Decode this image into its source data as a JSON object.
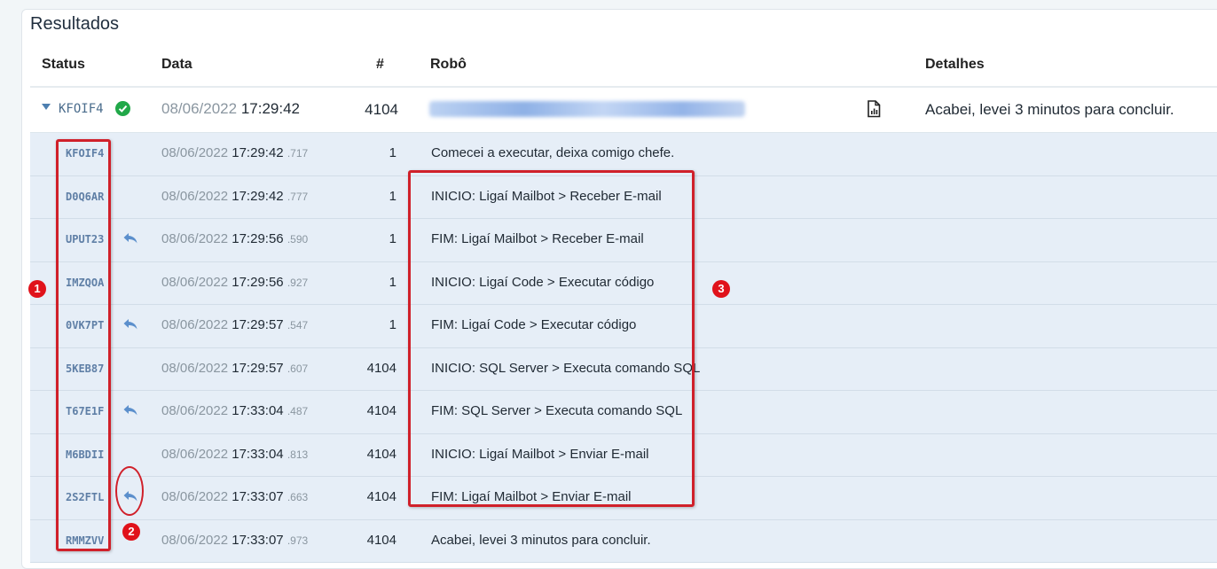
{
  "section_title": "Resultados",
  "columns": {
    "status": "Status",
    "data": "Data",
    "num": "#",
    "robo": "Robô",
    "detalhes": "Detalhes"
  },
  "main_row": {
    "code": "KFOIF4",
    "status_icon": "check-circle-icon",
    "date": "08/06/2022",
    "time": "17:29:42",
    "num": "4104",
    "robo": "(blurred)",
    "details_icon": "report-document-icon",
    "details": "Acabei, levei 3 minutos para concluir."
  },
  "log_rows": [
    {
      "code": "KFOIF4",
      "reply": false,
      "date": "08/06/2022",
      "time": "17:29:42",
      "ms": ".717",
      "num": "1",
      "msg": "Comecei a executar, deixa comigo chefe."
    },
    {
      "code": "D0Q6AR",
      "reply": false,
      "date": "08/06/2022",
      "time": "17:29:42",
      "ms": ".777",
      "num": "1",
      "msg": "INICIO: Ligaí Mailbot > Receber E-mail"
    },
    {
      "code": "UPUT23",
      "reply": true,
      "date": "08/06/2022",
      "time": "17:29:56",
      "ms": ".590",
      "num": "1",
      "msg": "FIM: Ligaí Mailbot > Receber E-mail"
    },
    {
      "code": "IMZQOA",
      "reply": false,
      "date": "08/06/2022",
      "time": "17:29:56",
      "ms": ".927",
      "num": "1",
      "msg": "INICIO: Ligaí Code > Executar código"
    },
    {
      "code": "0VK7PT",
      "reply": true,
      "date": "08/06/2022",
      "time": "17:29:57",
      "ms": ".547",
      "num": "1",
      "msg": "FIM: Ligaí Code > Executar código"
    },
    {
      "code": "5KEB87",
      "reply": false,
      "date": "08/06/2022",
      "time": "17:29:57",
      "ms": ".607",
      "num": "4104",
      "msg": "INICIO: SQL Server > Executa comando SQL"
    },
    {
      "code": "T67E1F",
      "reply": true,
      "date": "08/06/2022",
      "time": "17:33:04",
      "ms": ".487",
      "num": "4104",
      "msg": "FIM: SQL Server > Executa comando SQL"
    },
    {
      "code": "M6BDII",
      "reply": false,
      "date": "08/06/2022",
      "time": "17:33:04",
      "ms": ".813",
      "num": "4104",
      "msg": "INICIO: Ligaí Mailbot > Enviar E-mail"
    },
    {
      "code": "2S2FTL",
      "reply": true,
      "date": "08/06/2022",
      "time": "17:33:07",
      "ms": ".663",
      "num": "4104",
      "msg": "FIM: Ligaí Mailbot > Enviar E-mail"
    },
    {
      "code": "RMMZVV",
      "reply": false,
      "date": "08/06/2022",
      "time": "17:33:07",
      "ms": ".973",
      "num": "4104",
      "msg": "Acabei, levei 3 minutos para concluir."
    }
  ],
  "annotations": {
    "marker1": "1",
    "marker2": "2",
    "marker3": "3"
  },
  "colors": {
    "highlight": "#d0202a",
    "row_bg": "#e6eef7",
    "success": "#21a849",
    "link": "#5f7fa6"
  }
}
